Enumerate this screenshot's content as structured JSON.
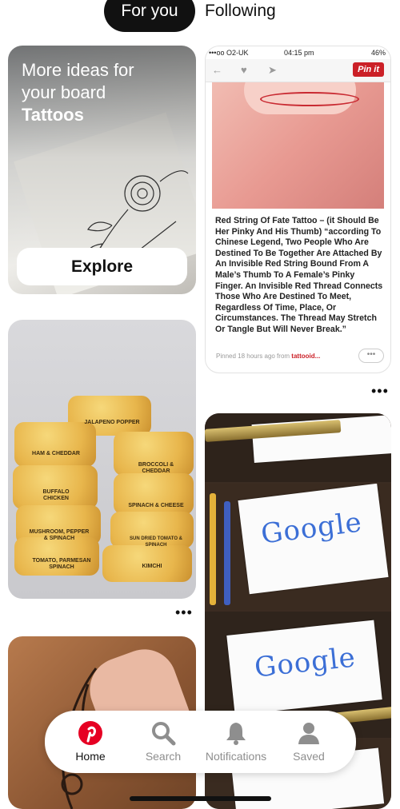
{
  "tabs": {
    "active": "For you",
    "following": "Following"
  },
  "board_card": {
    "line1": "More ideas for",
    "line2": "your board",
    "board_name": "Tattoos",
    "explore_label": "Explore"
  },
  "muffin_card": {
    "labels": [
      "JALAPENO POPPER",
      "HAM & CHEDDAR",
      "BROCCOLI & CHEDDAR",
      "BUFFALO CHICKEN",
      "SPINACH & CHEESE",
      "MUSHROOM, PEPPER & SPINACH",
      "SUN DRIED TOMATO & SPINACH",
      "TOMATO, PARMESAN SPINACH",
      "KIMCHI"
    ],
    "more": "•••"
  },
  "screenshot_card": {
    "carrier": "•••oo O2-UK",
    "time": "04:15 pm",
    "battery": "46%",
    "pin_it": "Pin it",
    "article": "Red String Of Fate Tattoo – (it Should Be Her Pinky And His Thumb) “according To Chinese Legend, Two People Who Are Destined To Be Together Are Attached By An Invisible Red String Bound From A Male’s Thumb To A Female’s Pinky Finger. An Invisible Red Thread Connects Those Who Are Destined To Meet, Regardless Of Time, Place, Or Circumstances. The Thread May Stretch Or Tangle But Will Never Break.”",
    "pinned_prefix": "Pinned 18 hours ago from",
    "pinned_source": "tattooid...",
    "more": "•••"
  },
  "google_card": {
    "word": "Google"
  },
  "nav": {
    "home": "Home",
    "search": "Search",
    "notifications": "Notifications",
    "saved": "Saved",
    "accent": "#e60023"
  }
}
